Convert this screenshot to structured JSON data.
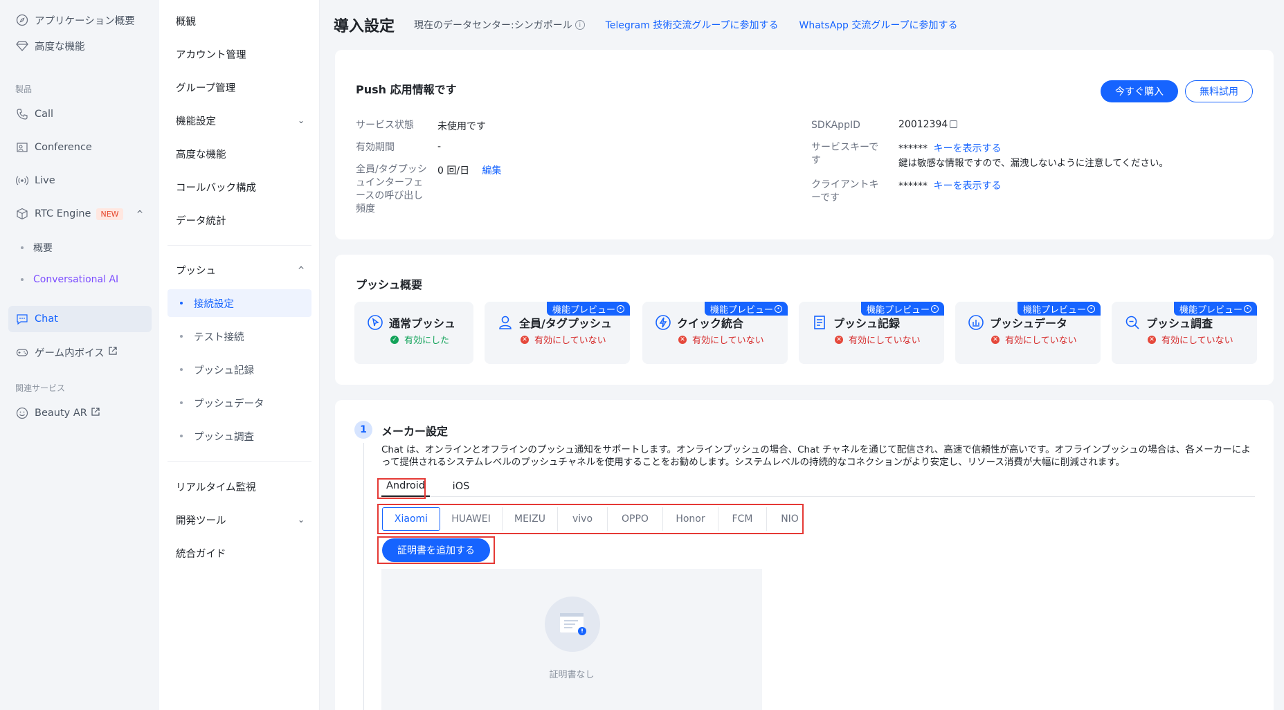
{
  "sidebar1": {
    "items": [
      {
        "label": "アプリケーション概要",
        "icon": "compass-icon"
      },
      {
        "label": "高度な機能",
        "icon": "diamond-icon"
      },
      {
        "label": "Call",
        "icon": "phone-icon"
      },
      {
        "label": "Conference",
        "icon": "conference-icon"
      },
      {
        "label": "Live",
        "icon": "broadcast-icon"
      },
      {
        "label": "RTC Engine",
        "icon": "cube-icon",
        "badge": "NEW"
      },
      {
        "label": "Chat",
        "icon": "chat-icon"
      },
      {
        "label": "ゲーム内ボイス",
        "icon": "gamepad-icon"
      },
      {
        "label": "Beauty AR",
        "icon": "smile-icon"
      }
    ],
    "section_products": "製品",
    "section_related": "関連サービス",
    "rtc_subitems": [
      "概要",
      "Conversational AI"
    ]
  },
  "sidebar2": {
    "items": [
      "概観",
      "アカウント管理",
      "グループ管理",
      "機能設定",
      "高度な機能",
      "コールバック構成",
      "データ統計"
    ],
    "push_label": "プッシュ",
    "push_subitems": [
      "接続設定",
      "テスト接続",
      "プッシュ記録",
      "プッシュデータ",
      "プッシュ調査"
    ],
    "bottom_items": [
      "リアルタイム監視",
      "開発ツール",
      "統合ガイド"
    ]
  },
  "header": {
    "title": "導入設定",
    "datacenter": "現在のデータセンター:シンガポール",
    "telegram_link": "Telegram 技術交流グループに参加する",
    "whatsapp_link": "WhatsApp 交流グループに参加する"
  },
  "push_info": {
    "title": "Push 応用情報です",
    "buy_button": "今すぐ購入",
    "trial_button": "無料試用",
    "service_status_label": "サービス状態",
    "service_status_value": "未使用です",
    "validity_label": "有効期間",
    "validity_value": "-",
    "frequency_label": "全員/タグプッシュインターフェースの呼び出し頻度",
    "frequency_value": "0 回/日",
    "edit_link": "編集",
    "sdkappid_label": "SDKAppID",
    "sdkappid_value": "20012394",
    "service_key_label": "サービスキーです",
    "masked_key": "******",
    "show_key_link": "キーを表示する",
    "key_warning": "鍵は敏感な情報ですので、漏洩しないように注意してください。",
    "client_key_label": "クライアントキーです"
  },
  "push_overview": {
    "title": "プッシュ概要",
    "preview_badge": "機能プレビュー",
    "tiles": [
      {
        "name": "通常プッシュ",
        "status": "有効にした",
        "enabled": true,
        "icon": "cursor-icon"
      },
      {
        "name": "全員/タグプッシュ",
        "status": "有効にしていない",
        "enabled": false,
        "icon": "user-icon"
      },
      {
        "name": "クイック統合",
        "status": "有効にしていない",
        "enabled": false,
        "icon": "lightning-icon"
      },
      {
        "name": "プッシュ記録",
        "status": "有効にしていない",
        "enabled": false,
        "icon": "document-icon"
      },
      {
        "name": "プッシュデータ",
        "status": "有効にしていない",
        "enabled": false,
        "icon": "chart-icon"
      },
      {
        "name": "プッシュ調査",
        "status": "有効にしていない",
        "enabled": false,
        "icon": "search-icon"
      }
    ]
  },
  "maker_settings": {
    "step": "1",
    "title": "メーカー設定",
    "description": "Chat は、オンラインとオフラインのプッシュ通知をサポートします。オンラインプッシュの場合、Chat チャネルを通じて配信され、高速で信頼性が高いです。オフラインプッシュの場合は、各メーカーによって提供されるシステムレベルのプッシュチャネルを使用することをお勧めします。システムレベルの持続的なコネクションがより安定し、リソース消費が大幅に削減されます。",
    "tabs": [
      "Android",
      "iOS"
    ],
    "makers": [
      "Xiaomi",
      "HUAWEI",
      "MEIZU",
      "vivo",
      "OPPO",
      "Honor",
      "FCM",
      "NIO"
    ],
    "add_cert_button": "証明書を追加する",
    "empty_text": "証明書なし"
  },
  "colors": {
    "accent": "#1664ff",
    "enabled": "#13a35a",
    "disabled": "#e5483b",
    "highlight_box": "#e53935"
  }
}
